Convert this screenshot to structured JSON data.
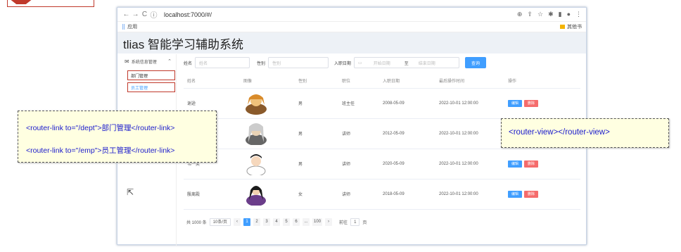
{
  "browser": {
    "url": "localhost:7000/#/",
    "bookmark_apps": "应用",
    "bookmark_other": "其他书"
  },
  "app": {
    "title": "tlias 智能学习辅助系统"
  },
  "sidebar": {
    "group": "系统信息管理",
    "items": [
      {
        "label": "部门管理"
      },
      {
        "label": "员工管理"
      }
    ]
  },
  "filters": {
    "name_label": "姓名",
    "name_ph": "姓名",
    "gender_label": "性别",
    "gender_ph": "性别",
    "date_label": "入职日期",
    "start_ph": "开始日期",
    "to": "至",
    "end_ph": "结束日期",
    "query": "查询"
  },
  "table": {
    "headers": [
      "姓名",
      "图像",
      "性别",
      "职位",
      "入职日期",
      "最后操作时间",
      "操作"
    ],
    "rows": [
      {
        "name": "谢逊",
        "gender": "男",
        "job": "班主任",
        "date": "2008-05-09",
        "updated": "2022-10-01 12:00:00"
      },
      {
        "name": "",
        "gender": "男",
        "job": "讲师",
        "date": "2012-05-09",
        "updated": "2022-10-01 12:00:00"
      },
      {
        "name": "韦一笑",
        "gender": "男",
        "job": "讲师",
        "date": "2020-05-09",
        "updated": "2022-10-01 12:00:00"
      },
      {
        "name": "殷离殿",
        "gender": "女",
        "job": "讲师",
        "date": "2018-05-09",
        "updated": "2022-10-01 12:00:00"
      }
    ],
    "edit": "编辑",
    "delete": "删除"
  },
  "pager": {
    "total": "共 1000 条",
    "size": "10条/页",
    "pages": [
      "1",
      "2",
      "3",
      "4",
      "5",
      "6",
      "...",
      "100"
    ],
    "goto": "前往",
    "goto_val": "1",
    "unit": "页"
  },
  "notes": {
    "router_dept": "<router-link to=\"/dept\">部门管理</router-link>",
    "router_emp": "<router-link to=\"/emp\">员工管理</router-link>",
    "router_view": "<router-view></router-view>"
  },
  "colors": {
    "primary": "#409eff",
    "danger": "#f56c6c",
    "accent_red": "#c0392b",
    "note_bg": "#ffffe1"
  }
}
